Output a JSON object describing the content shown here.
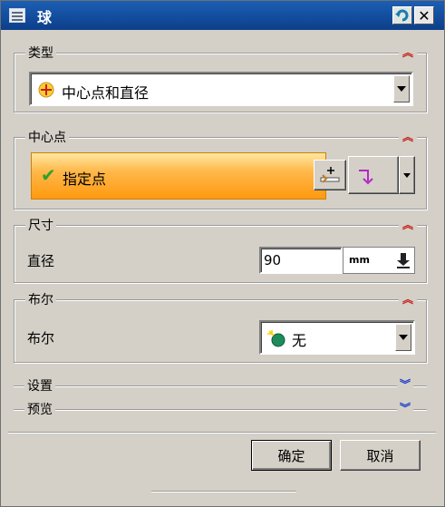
{
  "window": {
    "title": "球"
  },
  "type_group": {
    "title": "类型",
    "selected": "中心点和直径"
  },
  "center_group": {
    "title": "中心点",
    "specify_label": "指定点"
  },
  "size_group": {
    "title": "尺寸",
    "diameter_label": "直径",
    "diameter_value": "90",
    "unit": "mm"
  },
  "bool_group": {
    "title": "布尔",
    "bool_label": "布尔",
    "bool_value": "无"
  },
  "settings": {
    "title": "设置"
  },
  "preview": {
    "title": "预览"
  },
  "buttons": {
    "ok": "确定",
    "cancel": "取消"
  },
  "colors": {
    "title_bar": "#1b5fb4",
    "collapse_red": "#c81e1e",
    "expand_blue": "#1e3cc8",
    "highlight": "#ffb84a"
  }
}
